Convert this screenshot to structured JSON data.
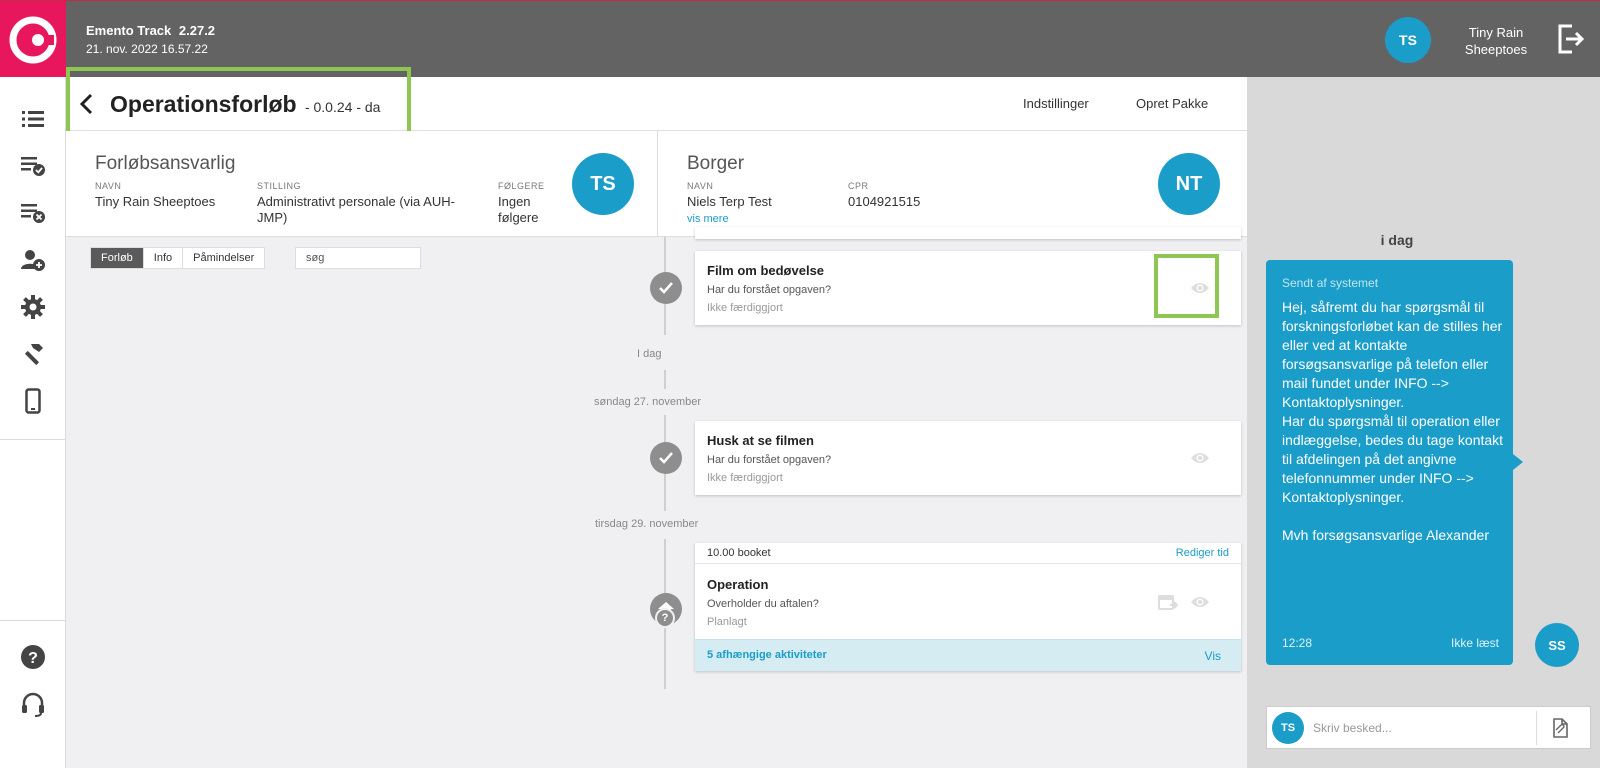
{
  "app": {
    "name": "Emento Track",
    "version": "2.27.2",
    "datetime": "21. nov. 2022 16.57.22"
  },
  "user": {
    "initials": "TS",
    "name_line1": "Tiny Rain",
    "name_line2": "Sheeptoes"
  },
  "sidebar": {
    "items": [
      {
        "name": "list-icon"
      },
      {
        "name": "list-check-icon"
      },
      {
        "name": "list-remove-icon"
      },
      {
        "name": "add-user-icon"
      },
      {
        "name": "gear-icon"
      },
      {
        "name": "hammer-icon"
      },
      {
        "name": "phone-icon"
      }
    ],
    "bottom": [
      {
        "name": "help-icon"
      },
      {
        "name": "headset-icon"
      }
    ]
  },
  "header": {
    "title": "Operationsforløb",
    "subtitle": "- 0.0.24 - da",
    "settings_label": "Indstillinger",
    "create_package_label": "Opret Pakke"
  },
  "responsible": {
    "title": "Forløbsansvarlig",
    "name_label": "NAVN",
    "name": "Tiny Rain Sheeptoes",
    "position_label": "STILLING",
    "position_line1": "Administrativt personale (via AUH-",
    "position_line2": "JMP)",
    "followers_label": "FØLGERE",
    "followers_line1": "Ingen",
    "followers_line2": "følgere",
    "initials": "TS"
  },
  "citizen": {
    "title": "Borger",
    "name_label": "NAVN",
    "name": "Niels Terp Test",
    "cpr_label": "CPR",
    "cpr": "0104921515",
    "more_link": "vis mere",
    "initials": "NT"
  },
  "filters": {
    "tabs": [
      "Forløb",
      "Info",
      "Påmindelser"
    ],
    "active_tab": "Forløb",
    "search_placeholder": "søg"
  },
  "timeline": {
    "today_label": "I dag",
    "day_nov27": "søndag 27. november",
    "day_nov29": "tirsdag 29. november",
    "card1": {
      "title": "Film om bedøvelse",
      "question": "Har du forstået opgaven?",
      "status": "Ikke færdiggjort"
    },
    "card2": {
      "title": "Husk at se filmen",
      "question": "Har du forstået opgaven?",
      "status": "Ikke færdiggjort"
    },
    "card3": {
      "booked": "10.00 booket",
      "edit_time": "Rediger tid",
      "title": "Operation",
      "question": "Overholder du aftalen?",
      "status": "Planlagt",
      "dependent": "5 afhængige aktiviteter",
      "show": "Vis"
    }
  },
  "chat": {
    "day": "i dag",
    "from": "Sendt af systemet",
    "message": "Hej, såfremt du har spørgsmål til forskningsforløbet kan de stilles her eller ved at kontakte forsøgsansvarlige på telefon eller mail fundet under INFO --> Kontaktoplysninger.\nHar du spørgsmål til operation eller indlæggelse, bedes du tage kontakt til afdelingen på det angivne telefonnummer under INFO --> Kontaktoplysninger.\n\nMvh forsøgsansvarlige Alexander",
    "time": "12:28",
    "read_status": "Ikke læst",
    "sender_initials": "SS",
    "compose_initials": "TS",
    "compose_placeholder": "Skriv besked..."
  },
  "colors": {
    "brand": "#e8175d",
    "accent": "#1a9dc8",
    "topbar": "#636363",
    "highlight": "#8ec653"
  }
}
